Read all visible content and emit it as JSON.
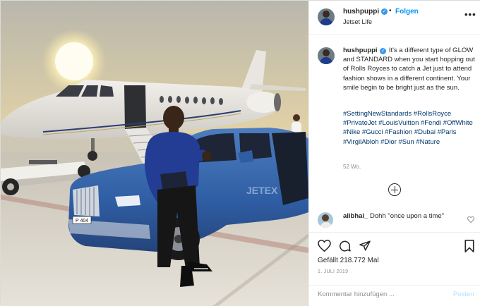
{
  "header": {
    "username": "hushpuppi",
    "dot": "•",
    "follow_label": "Folgen",
    "location": "Jetset Life",
    "more_icon": "more-horizontal-icon"
  },
  "caption": {
    "username": "hushpuppi",
    "text": "It's a different type of GLOW and STANDARD when you start hopping out of Rolls Royces to catch a Jet just to attend fashion shows in a different continent. Your smile begin to be bright just as the sun.",
    "hashtags": "#SettingNewStandards #RollsRoyce #PrivateJet #LouisVuitton #Fendi #OffWhite #Nike #Gucci #Fashion #Dubai #Paris #VirgilAbloh #Dior #Sun #Nature",
    "age": "52 Wo."
  },
  "comment": {
    "username": "alibhai_",
    "text": "Dohh \"once upon a time\""
  },
  "photo": {
    "car_plate": "P 404",
    "car_text": "JETEX"
  },
  "engagement": {
    "likes": "Gefällt 218.772 Mal",
    "date": "1. JULI 2019"
  },
  "add_comment": {
    "placeholder": "Kommentar hinzufügen ...",
    "post_label": "Posten"
  },
  "colors": {
    "link": "#00376b",
    "follow": "#0095f6",
    "verified": "#3897f0",
    "muted": "#8e8e8e"
  }
}
